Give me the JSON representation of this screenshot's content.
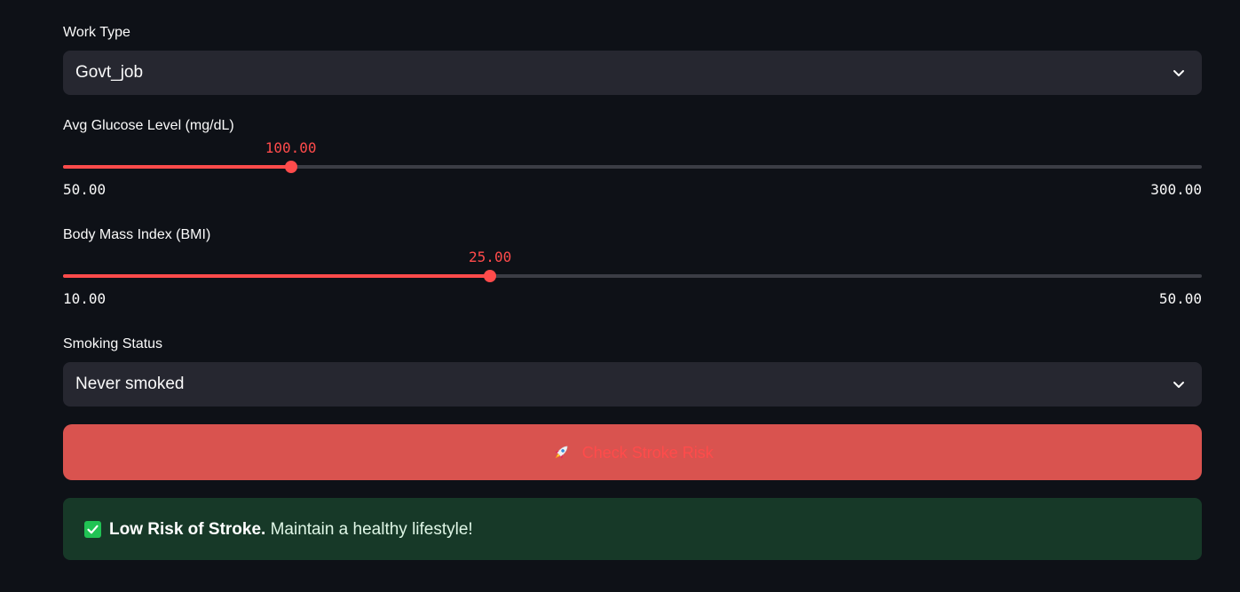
{
  "work_type": {
    "label": "Work Type",
    "selected": "Govt_job"
  },
  "glucose": {
    "label": "Avg Glucose Level (mg/dL)",
    "value": 100.0,
    "value_text": "100.00",
    "min": 50,
    "max": 300,
    "min_text": "50.00",
    "max_text": "300.00"
  },
  "bmi": {
    "label": "Body Mass Index (BMI)",
    "value": 25.0,
    "value_text": "25.00",
    "min": 10,
    "max": 50,
    "min_text": "10.00",
    "max_text": "50.00"
  },
  "smoking": {
    "label": "Smoking Status",
    "selected": "Never smoked"
  },
  "submit": {
    "icon": "rocket-icon",
    "label": "Check Stroke Risk"
  },
  "result": {
    "icon": "check-box-icon",
    "bold": "Low Risk of Stroke.",
    "text": " Maintain a healthy lifestyle!"
  },
  "colors": {
    "background": "#0e1117",
    "accent": "#ff4b4b",
    "input_bg": "#262730",
    "button_bg": "#d9534f",
    "success_bg": "#173928",
    "success_icon": "#21c354"
  }
}
